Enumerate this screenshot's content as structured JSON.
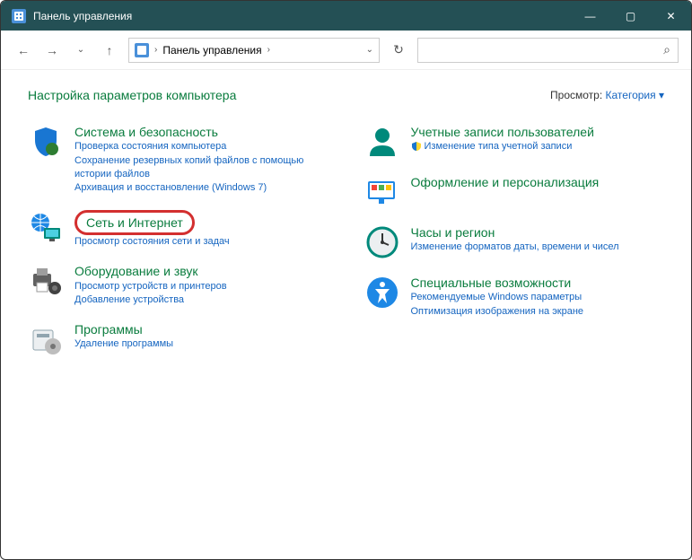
{
  "window": {
    "title": "Панель управления"
  },
  "breadcrumb": {
    "root": "Панель управления"
  },
  "header": {
    "heading": "Настройка параметров компьютера",
    "view_label": "Просмотр:",
    "view_value": "Категория"
  },
  "categories": {
    "left": [
      {
        "title": "Система и безопасность",
        "links": [
          "Проверка состояния компьютера",
          "Сохранение резервных копий файлов с помощью истории файлов",
          "Архивация и восстановление (Windows 7)"
        ]
      },
      {
        "title": "Сеть и Интернет",
        "links": [
          "Просмотр состояния сети и задач"
        ],
        "highlighted": true
      },
      {
        "title": "Оборудование и звук",
        "links": [
          "Просмотр устройств и принтеров",
          "Добавление устройства"
        ]
      },
      {
        "title": "Программы",
        "links": [
          "Удаление программы"
        ]
      }
    ],
    "right": [
      {
        "title": "Учетные записи пользователей",
        "links": [
          "Изменение типа учетной записи"
        ],
        "shield": true
      },
      {
        "title": "Оформление и персонализация",
        "links": []
      },
      {
        "title": "Часы и регион",
        "links": [
          "Изменение форматов даты, времени и чисел"
        ]
      },
      {
        "title": "Специальные возможности",
        "links": [
          "Рекомендуемые Windows параметры",
          "Оптимизация изображения на экране"
        ]
      }
    ]
  },
  "icons": {
    "system": "shield-icon",
    "network": "globe-monitor-icon",
    "hardware": "printer-icon",
    "programs": "box-icon",
    "users": "user-icon",
    "appearance": "monitor-tiles-icon",
    "clock": "clock-icon",
    "access": "accessibility-icon"
  }
}
